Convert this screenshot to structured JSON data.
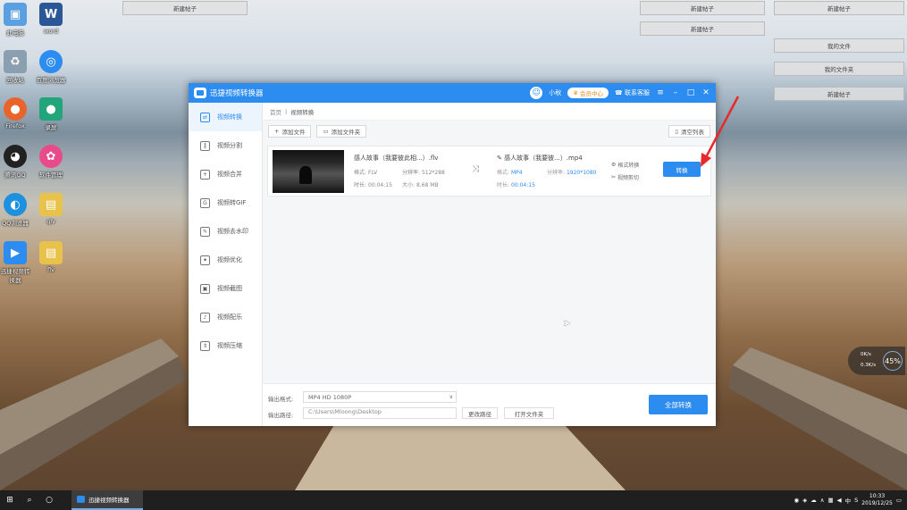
{
  "desktop": {
    "icons": [
      {
        "label": "此电脑",
        "glyph": "▣",
        "color": "#5aa0e0"
      },
      {
        "label": "word",
        "glyph": "W",
        "color": "#2b5797"
      },
      {
        "label": "回收站",
        "glyph": "♻",
        "color": "#8aa0b0"
      },
      {
        "label": "百度浏览器",
        "glyph": "◎",
        "color": "#2d8cf0"
      },
      {
        "label": "Firefox",
        "glyph": "●",
        "color": "#e8642a"
      },
      {
        "label": "录屏",
        "glyph": "●",
        "color": "#22a57a"
      },
      {
        "label": "腾讯QQ",
        "glyph": "◕",
        "color": "#222222"
      },
      {
        "label": "软件管理",
        "glyph": "✿",
        "color": "#e84a8a"
      },
      {
        "label": "QQ浏览器",
        "glyph": "◐",
        "color": "#1e90e0"
      },
      {
        "label": "qlv",
        "glyph": "▤",
        "color": "#e8c24a"
      },
      {
        "label": "迅捷视频转换器",
        "glyph": "▶",
        "color": "#2d8cf0"
      },
      {
        "label": "flv",
        "glyph": "▤",
        "color": "#e8c24a"
      }
    ],
    "posts": [
      "新建帖子",
      "新建帖子",
      "新建帖子",
      "新建帖子",
      "我的文件",
      "我的文件夹",
      "新建帖子"
    ]
  },
  "app": {
    "title": "迅捷视频转换器",
    "user_name": "小秋",
    "vip_label": "会员中心",
    "contact_label": "联系客服",
    "sidebar": [
      {
        "label": "视频转换",
        "glyph": "⇄",
        "active": true
      },
      {
        "label": "视频分割",
        "glyph": "‖",
        "active": false
      },
      {
        "label": "视频合并",
        "glyph": "+",
        "active": false
      },
      {
        "label": "视频转GIF",
        "glyph": "G",
        "active": false
      },
      {
        "label": "视频去水印",
        "glyph": "✎",
        "active": false
      },
      {
        "label": "视频优化",
        "glyph": "✦",
        "active": false
      },
      {
        "label": "视频截图",
        "glyph": "▣",
        "active": false
      },
      {
        "label": "视频配乐",
        "glyph": "♪",
        "active": false
      },
      {
        "label": "视频压缩",
        "glyph": "⇕",
        "active": false
      }
    ],
    "breadcrumb": {
      "home": "首页",
      "sep": "|",
      "current": "视频转换"
    },
    "toolbar": {
      "add_file": "添加文件",
      "add_folder": "添加文件夹",
      "clear_list": "清空列表"
    },
    "file": {
      "src_name": "感人故事（我要彼此相...）.flv",
      "src_format_label": "格式:",
      "src_format": "FLV",
      "src_res_label": "分辨率:",
      "src_res": "512*288",
      "src_time_label": "时长:",
      "src_time": "00:04:15",
      "src_size_label": "大小:",
      "src_size": "8.68 MB",
      "dst_name": "感人故事（我要彼...）.mp4",
      "dst_format_label": "格式:",
      "dst_format": "MP4",
      "dst_res_label": "分辨率:",
      "dst_res": "1920*1080",
      "dst_time_label": "时长:",
      "dst_time": "00:04:15",
      "opt_format": "格式转换",
      "opt_clip": "视频剪切",
      "convert_label": "转换"
    },
    "bottom": {
      "format_label": "输出格式:",
      "format_value": "MP4  HD 1080P",
      "path_label": "输出路径:",
      "path_value": "C:\\Users\\Mloong\\Desktop",
      "change_path": "更改路径",
      "open_folder": "打开文件夹",
      "convert_all": "全部转换"
    }
  },
  "taskbar": {
    "app_label": "迅捷视频转换器",
    "clock_time": "10:33",
    "clock_date": "2019/12/25",
    "ime": "中"
  },
  "speed_widget": {
    "up": "0K/s",
    "down": "0.3K/s",
    "percent": "45%"
  }
}
